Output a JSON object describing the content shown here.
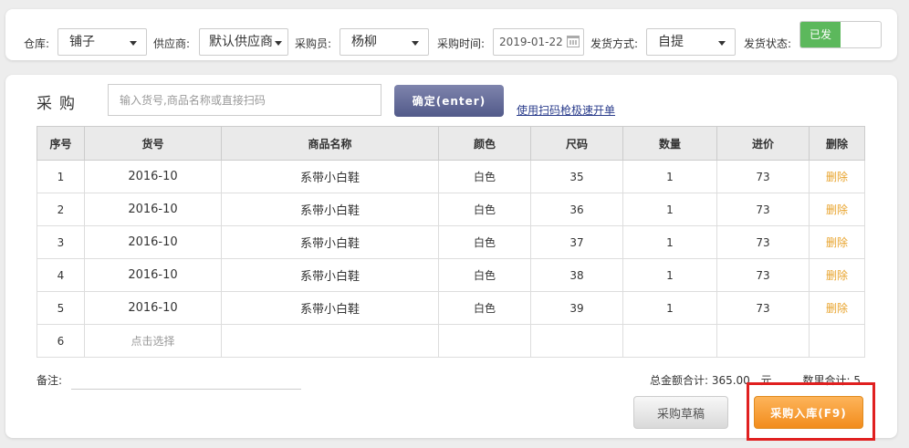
{
  "filters": {
    "warehouse": {
      "label": "仓库:",
      "value": "铺子"
    },
    "supplier": {
      "label": "供应商:",
      "value": "默认供应商"
    },
    "buyer": {
      "label": "采购员:",
      "value": "杨柳"
    },
    "purchase_time": {
      "label": "采购时间:",
      "value": "2019-01-22"
    },
    "shipping_method": {
      "label": "发货方式:",
      "value": "自提"
    },
    "shipping_status": {
      "label": "发货状态:",
      "value": "已发"
    }
  },
  "purchase": {
    "title": "采购",
    "search_placeholder": "输入货号,商品名称或直接扫码",
    "confirm_label": "确定(enter)",
    "scan_link": "使用扫码枪极速开单"
  },
  "table": {
    "headers": [
      "序号",
      "货号",
      "商品名称",
      "颜色",
      "尺码",
      "数量",
      "进价",
      "删除"
    ],
    "rows": [
      {
        "no": "1",
        "sku": "2016-10",
        "name": "系带小白鞋",
        "color": "白色",
        "size": "35",
        "qty": "1",
        "price": "73",
        "delete": "删除"
      },
      {
        "no": "2",
        "sku": "2016-10",
        "name": "系带小白鞋",
        "color": "白色",
        "size": "36",
        "qty": "1",
        "price": "73",
        "delete": "删除"
      },
      {
        "no": "3",
        "sku": "2016-10",
        "name": "系带小白鞋",
        "color": "白色",
        "size": "37",
        "qty": "1",
        "price": "73",
        "delete": "删除"
      },
      {
        "no": "4",
        "sku": "2016-10",
        "name": "系带小白鞋",
        "color": "白色",
        "size": "38",
        "qty": "1",
        "price": "73",
        "delete": "删除"
      },
      {
        "no": "5",
        "sku": "2016-10",
        "name": "系带小白鞋",
        "color": "白色",
        "size": "39",
        "qty": "1",
        "price": "73",
        "delete": "删除"
      }
    ],
    "empty_row": {
      "no": "6",
      "choose": "点击选择"
    }
  },
  "footer": {
    "remark_label": "备注:",
    "total_amount_label": "总金额合计:",
    "total_amount": "365.00",
    "currency": "元",
    "total_qty_label": "数里合计:",
    "total_qty": "5",
    "draft_label": "采购草稿",
    "submit_label": "采购入库(F9)"
  },
  "colors": {
    "toggle_on": "#5cb85c",
    "confirm_button": "#5a6190",
    "submit_button": "#f5962a",
    "delete_link": "#e8a32c",
    "highlight": "#e02020"
  }
}
